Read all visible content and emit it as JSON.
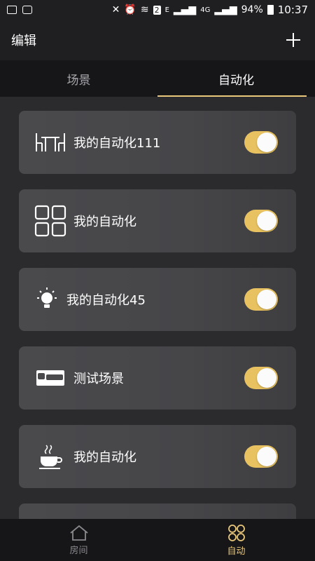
{
  "statusbar": {
    "battery": "94%",
    "time": "10:37",
    "sim_badge": "2",
    "network_e": "E",
    "network_4g": "4G"
  },
  "header": {
    "title": "编辑",
    "add_icon": "plus-icon"
  },
  "tabs": [
    {
      "label": "场景",
      "active": false
    },
    {
      "label": "自动化",
      "active": true
    }
  ],
  "automations": [
    {
      "label": "我的自动化111",
      "icon": "dining-table-icon",
      "enabled": true
    },
    {
      "label": "我的自动化",
      "icon": "grid-icon",
      "enabled": true
    },
    {
      "label": "我的自动化45",
      "icon": "light-bulb-icon",
      "enabled": true
    },
    {
      "label": "测试场景",
      "icon": "bed-icon",
      "enabled": true
    },
    {
      "label": "我的自动化",
      "icon": "coffee-cup-icon",
      "enabled": true
    }
  ],
  "bottom_nav": [
    {
      "label": "房间",
      "icon": "home-icon",
      "active": false
    },
    {
      "label": "自动",
      "icon": "clover-icon",
      "active": true
    }
  ],
  "colors": {
    "accent": "#e8c77a",
    "toggle_on": "#e8c260",
    "card_bg": "#4a4a4d",
    "page_bg": "#2b2a2d"
  }
}
